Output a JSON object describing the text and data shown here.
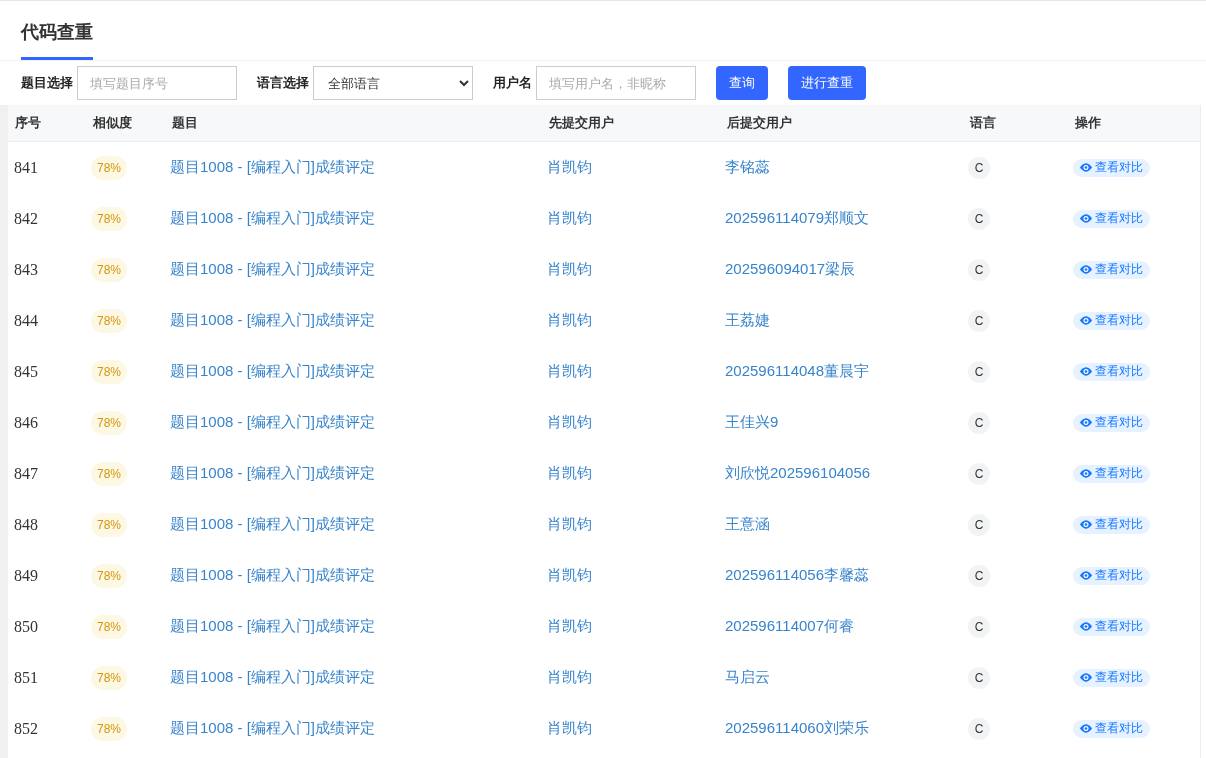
{
  "tabs": [
    {
      "label": "代码查重",
      "selected": true
    }
  ],
  "filters": [
    {
      "kind": "text",
      "label": "题目选择",
      "placeholder": "填写题目序号"
    },
    {
      "kind": "select",
      "label": "语言选择",
      "value": "全部语言"
    },
    {
      "kind": "text",
      "label": "用户名",
      "placeholder": "填写用户名，非昵称"
    }
  ],
  "buttons": [
    "查询",
    "进行查重"
  ],
  "table": {
    "columns": [
      "序号",
      "相似度",
      "题目",
      "先提交用户",
      "后提交用户",
      "语言",
      "操作"
    ],
    "rows": [
      {
        "number": "841",
        "similarity": "78%",
        "problem": "题目1008 - [编程入门]成绩评定",
        "first_user": "肖凯钧",
        "second_user": "李铭蕊",
        "language": "C",
        "action": "查看对比"
      },
      {
        "number": "842",
        "similarity": "78%",
        "problem": "题目1008 - [编程入门]成绩评定",
        "first_user": "肖凯钧",
        "second_user": "202596114079郑顺文",
        "language": "C",
        "action": "查看对比"
      },
      {
        "number": "843",
        "similarity": "78%",
        "problem": "题目1008 - [编程入门]成绩评定",
        "first_user": "肖凯钧",
        "second_user": "202596094017梁辰",
        "language": "C",
        "action": "查看对比"
      },
      {
        "number": "844",
        "similarity": "78%",
        "problem": "题目1008 - [编程入门]成绩评定",
        "first_user": "肖凯钧",
        "second_user": "王荔婕",
        "language": "C",
        "action": "查看对比"
      },
      {
        "number": "845",
        "similarity": "78%",
        "problem": "题目1008 - [编程入门]成绩评定",
        "first_user": "肖凯钧",
        "second_user": "202596114048董晨宇",
        "language": "C",
        "action": "查看对比"
      },
      {
        "number": "846",
        "similarity": "78%",
        "problem": "题目1008 - [编程入门]成绩评定",
        "first_user": "肖凯钧",
        "second_user": "王佳兴9",
        "language": "C",
        "action": "查看对比"
      },
      {
        "number": "847",
        "similarity": "78%",
        "problem": "题目1008 - [编程入门]成绩评定",
        "first_user": "肖凯钧",
        "second_user": "刘欣悦202596104056",
        "language": "C",
        "action": "查看对比"
      },
      {
        "number": "848",
        "similarity": "78%",
        "problem": "题目1008 - [编程入门]成绩评定",
        "first_user": "肖凯钧",
        "second_user": "王意涵",
        "language": "C",
        "action": "查看对比"
      },
      {
        "number": "849",
        "similarity": "78%",
        "problem": "题目1008 - [编程入门]成绩评定",
        "first_user": "肖凯钧",
        "second_user": "202596114056李馨蕊",
        "language": "C",
        "action": "查看对比"
      },
      {
        "number": "850",
        "similarity": "78%",
        "problem": "题目1008 - [编程入门]成绩评定",
        "first_user": "肖凯钧",
        "second_user": "202596114007何睿",
        "language": "C",
        "action": "查看对比"
      },
      {
        "number": "851",
        "similarity": "78%",
        "problem": "题目1008 - [编程入门]成绩评定",
        "first_user": "肖凯钧",
        "second_user": "马启云",
        "language": "C",
        "action": "查看对比"
      },
      {
        "number": "852",
        "similarity": "78%",
        "problem": "题目1008 - [编程入门]成绩评定",
        "first_user": "肖凯钧",
        "second_user": "202596114060刘荣乐",
        "language": "C",
        "action": "查看对比"
      }
    ]
  }
}
